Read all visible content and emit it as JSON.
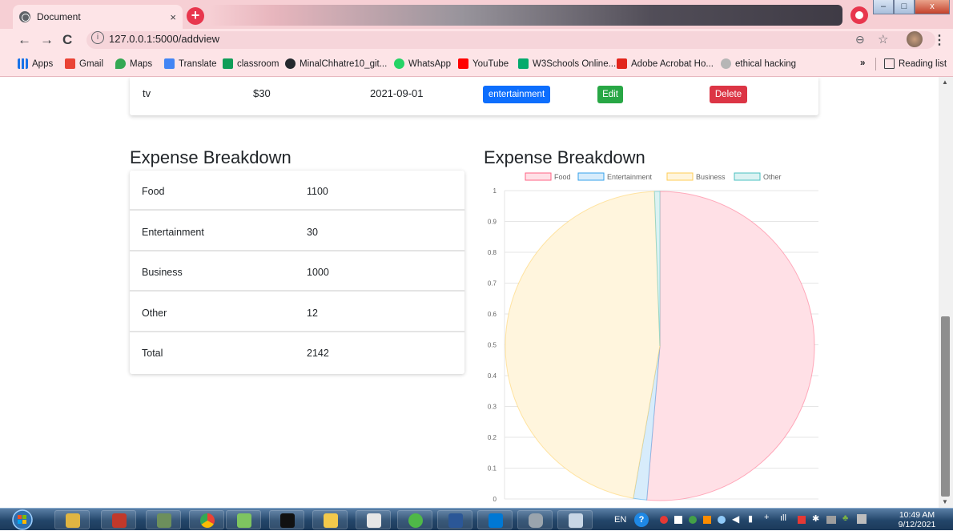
{
  "browser": {
    "tab_title": "Document",
    "tab_close": "×",
    "new_tab": "+",
    "url": "127.0.0.1:5000/addview",
    "bookmarks": [
      "Apps",
      "Gmail",
      "Maps",
      "Translate",
      "classroom",
      "MinalChhatre10_git...",
      "WhatsApp",
      "YouTube",
      "W3Schools Online...",
      "Adobe Acrobat Ho...",
      "ethical hacking"
    ],
    "more_bookmarks": "»",
    "reading_list": "Reading list"
  },
  "expense_row": {
    "name": "tv",
    "amount": "$30",
    "date": "2021-09-01",
    "category": "entertainment",
    "edit_label": "Edit",
    "delete_label": "Delete"
  },
  "summary": {
    "heading": "Expense Breakdown",
    "rows": [
      {
        "label": "Food",
        "value": "1100"
      },
      {
        "label": "Entertainment",
        "value": "30"
      },
      {
        "label": "Business",
        "value": "1000"
      },
      {
        "label": "Other",
        "value": "12"
      },
      {
        "label": "Total",
        "value": "2142"
      }
    ]
  },
  "chart_heading": "Expense Breakdown",
  "chart_data": {
    "type": "pie",
    "title": "",
    "labels": [
      "Food",
      "Entertainment",
      "Business",
      "Other"
    ],
    "values": [
      1100,
      30,
      1000,
      12
    ],
    "colors": {
      "fill": [
        "#ffe0e6",
        "#d7ecfb",
        "#fff5dd",
        "#dbf2f2"
      ],
      "stroke": [
        "#ff6384",
        "#36a2eb",
        "#ffcd56",
        "#4bc0c0"
      ]
    },
    "legend": "top",
    "ylim": [
      0,
      1
    ],
    "yticks": [
      "0",
      "0.1",
      "0.2",
      "0.3",
      "0.4",
      "0.5",
      "0.6",
      "0.7",
      "0.8",
      "0.9",
      "1"
    ],
    "grid": true
  },
  "taskbar": {
    "tray_lang": "EN",
    "time": "10:49 AM",
    "date": "9/12/2021"
  }
}
